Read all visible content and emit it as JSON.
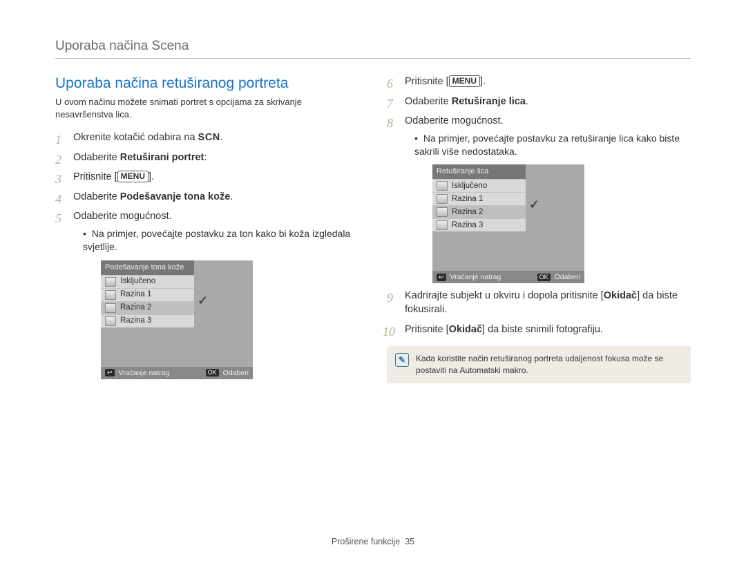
{
  "header": "Uporaba načina Scena",
  "menu": "MENU",
  "tagBack": "↩",
  "tagOk": "OK",
  "footBack": "Vraćanje natrag",
  "footOk": "Odaberi",
  "left": {
    "title": "Uporaba načina retuširanog portreta",
    "intro": "U ovom načinu možete snimati portret s opcijama za skrivanje nesavršenstva lica.",
    "s1a": "Okrenite kotačić odabira na",
    "scn": "SCN",
    "s1b": ".",
    "s2a": "Odaberite",
    "s2b": "Retuširani portret",
    "s2c": ":",
    "s3a": "Pritisnite",
    "s3b": ".",
    "s4a": "Odaberite",
    "s4b": "Podešavanje tona kože",
    "s4c": ".",
    "s5": "Odaberite mogućnost.",
    "bullet": "Na primjer, povećajte postavku za ton kako bi koža izgledala svjetlije.",
    "cam": {
      "title": "Podešavanje tona kože",
      "o0": "Isključeno",
      "o1": "Razina 1",
      "o2": "Razina 2",
      "o3": "Razina 3"
    }
  },
  "right": {
    "s6a": "Pritisnite",
    "s6b": ".",
    "s7a": "Odaberite",
    "s7b": "Retuširanje lica",
    "s7c": ".",
    "s8": "Odaberite mogućnost.",
    "bullet": "Na primjer, povećajte postavku za retuširanje lica kako biste sakrili više nedostataka.",
    "cam": {
      "title": "Retuširanje lica",
      "o0": "Isključeno",
      "o1": "Razina 1",
      "o2": "Razina 2",
      "o3": "Razina 3"
    },
    "s9a": "Kadrirajte subjekt u okviru i dopola pritisnite",
    "s9b": "Okidač",
    "s9c": "da biste fokusirali.",
    "s10a": "Pritisnite",
    "s10b": "Okidač",
    "s10c": "da biste snimili fotografiju.",
    "note": "Kada koristite način retuširanog portreta udaljenost fokusa može se postaviti na Automatski makro."
  },
  "footer": {
    "section": "Proširene funkcije",
    "page": "35"
  }
}
